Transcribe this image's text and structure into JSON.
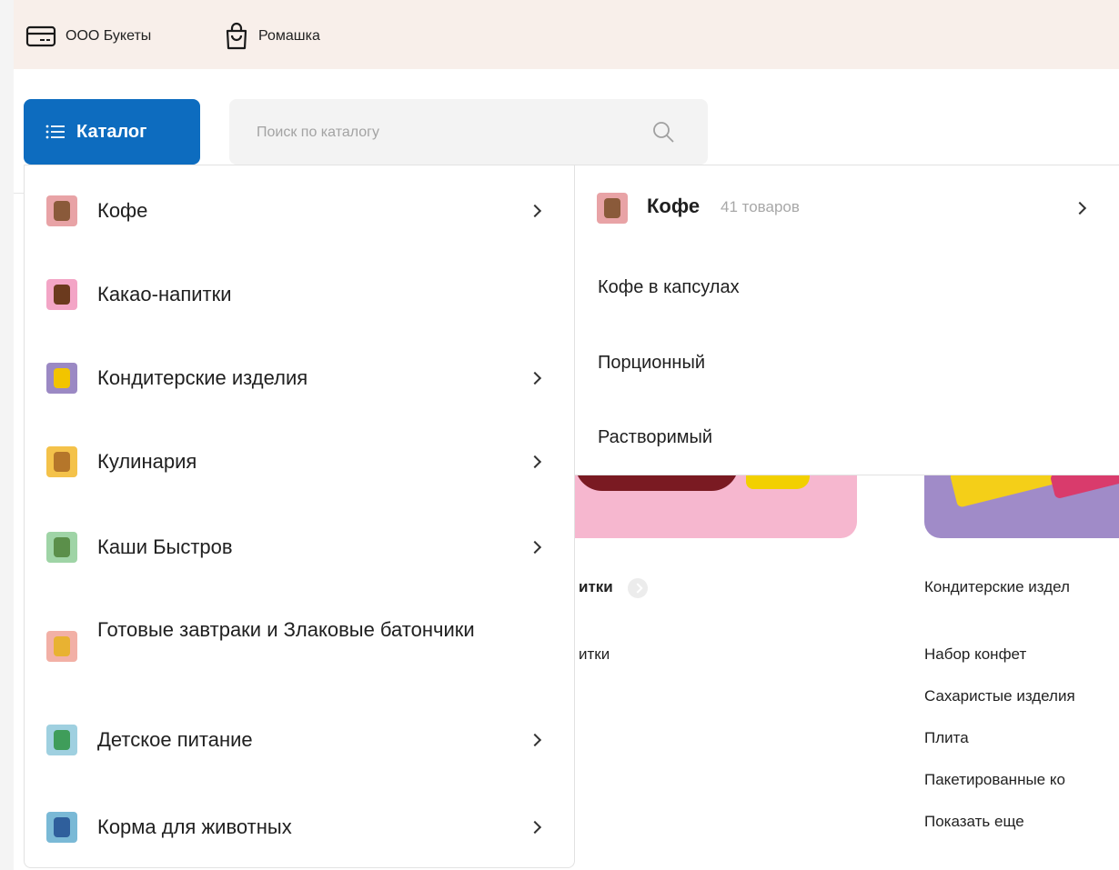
{
  "topbar": {
    "company_label": "ООО Букеты",
    "store_label": "Ромашка",
    "company_icon": "card-icon",
    "store_icon": "shopping-bag-icon"
  },
  "header": {
    "catalog_label": "Каталог",
    "search_placeholder": "Поиск по каталогу",
    "accent_color": "#0d6cbf"
  },
  "categories": [
    {
      "label": "Кофе",
      "has_children": true,
      "thumb_color": "#e8a3a6"
    },
    {
      "label": "Какао-напитки",
      "has_children": false,
      "thumb_color": "#f3a5c6"
    },
    {
      "label": "Кондитерские изделия",
      "has_children": true,
      "thumb_color": "#9b89c4"
    },
    {
      "label": "Кулинария",
      "has_children": true,
      "thumb_color": "#f4c24a"
    },
    {
      "label": "Каши Быстров",
      "has_children": true,
      "thumb_color": "#9fd4a6"
    },
    {
      "label": "Готовые завтраки и Злаковые батончики",
      "has_children": false,
      "thumb_color": "#f2b0a6"
    },
    {
      "label": "Детское питание",
      "has_children": true,
      "thumb_color": "#9fd0e0"
    },
    {
      "label": "Корма для животных",
      "has_children": true,
      "thumb_color": "#7ab9d6"
    }
  ],
  "submenu": {
    "title": "Кофе",
    "count": "41 товаров",
    "items": [
      "Кофе в капсулах",
      "Порционный",
      "Растворимый"
    ]
  },
  "background": {
    "cocoa_heading": "итки",
    "cocoa_link": "итки",
    "confect_heading": "Кондитерские издел",
    "confect_links": [
      "Набор конфет",
      "Сахаристые изделия",
      "Плита",
      "Пакетированные ко",
      "Показать еще"
    ]
  }
}
